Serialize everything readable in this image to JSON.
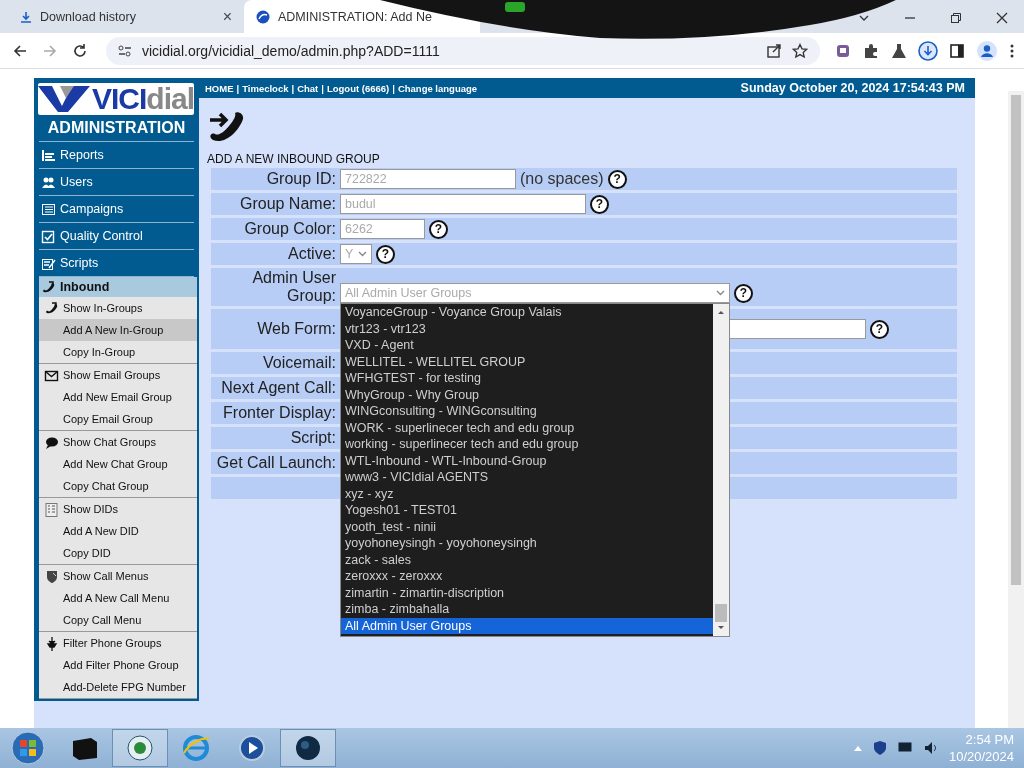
{
  "browser": {
    "tabs": [
      {
        "title": "Download history",
        "selected": false,
        "close": "×"
      },
      {
        "title": "ADMINISTRATION: Add Ne",
        "selected": true
      }
    ],
    "url": "vicidial.org/vicidial_demo/admin.php?ADD=1111"
  },
  "sidebar": {
    "logo": {
      "part_1": "VICI",
      "part_2": "dial"
    },
    "title": "ADMINISTRATION",
    "sections": [
      {
        "label": "Reports",
        "expanded": false
      },
      {
        "label": "Users",
        "expanded": false
      },
      {
        "label": "Campaigns",
        "expanded": false
      },
      {
        "label": "Quality Control",
        "expanded": false
      },
      {
        "label": "Scripts",
        "expanded": false
      },
      {
        "label": "Inbound",
        "expanded": true,
        "groups": [
          [
            {
              "label": "Show In-Groups",
              "selected": false
            },
            {
              "label": "Add A New In-Group",
              "selected": true
            },
            {
              "label": "Copy In-Group",
              "selected": false
            }
          ],
          [
            {
              "label": "Show Email Groups",
              "selected": false
            },
            {
              "label": "Add New Email Group",
              "selected": false
            },
            {
              "label": "Copy Email Group",
              "selected": false
            }
          ],
          [
            {
              "label": "Show Chat Groups",
              "selected": false
            },
            {
              "label": "Add New Chat Group",
              "selected": false
            },
            {
              "label": "Copy Chat Group",
              "selected": false
            }
          ],
          [
            {
              "label": "Show DIDs",
              "selected": false
            },
            {
              "label": "Add A New DID",
              "selected": false
            },
            {
              "label": "Copy DID",
              "selected": false
            }
          ],
          [
            {
              "label": "Show Call Menus",
              "selected": false
            },
            {
              "label": "Add A New Call Menu",
              "selected": false
            },
            {
              "label": "Copy Call Menu",
              "selected": false
            }
          ],
          [
            {
              "label": "Filter Phone Groups",
              "selected": false
            },
            {
              "label": "Add Filter Phone Group",
              "selected": false
            },
            {
              "label": "Add-Delete FPG Number",
              "selected": false
            }
          ]
        ]
      }
    ]
  },
  "top_links": {
    "separator": "|",
    "links": [
      "HOME",
      "Timeclock",
      "Chat",
      "Logout (6666)",
      "Change language"
    ]
  },
  "datetime": "Sunday October 20, 2024 17:54:43 PM",
  "form": {
    "title": "ADD A NEW INBOUND GROUP",
    "fields": [
      {
        "label": "Group ID:",
        "kind": "text",
        "value": "722822",
        "note": "(no spaces)",
        "help": "?"
      },
      {
        "label": "Group Name:",
        "kind": "text",
        "value": "budul",
        "help": "?"
      },
      {
        "label": "Group Color:",
        "kind": "text",
        "value": "6262",
        "help": "?"
      },
      {
        "label": "Active:",
        "kind": "select",
        "value": "Y",
        "help": "?"
      },
      {
        "label": "Admin User Group:",
        "kind": "open-select",
        "value": "All Admin User Groups",
        "help": "?",
        "options": [
          {
            "label": "VoyanceGroup - Voyance Group Valais",
            "selected": false
          },
          {
            "label": "vtr123 - vtr123",
            "selected": false
          },
          {
            "label": "VXD - Agent",
            "selected": false
          },
          {
            "label": "WELLITEL - WELLITEL GROUP",
            "selected": false
          },
          {
            "label": "WFHGTEST - for testing",
            "selected": false
          },
          {
            "label": "WhyGroup - Why Group",
            "selected": false
          },
          {
            "label": "WINGconsulting - WINGconsulting",
            "selected": false
          },
          {
            "label": "WORK - superlinecer tech and edu group",
            "selected": false
          },
          {
            "label": "working - superlinecer tech and edu group",
            "selected": false
          },
          {
            "label": "WTL-Inbound - WTL-Inbound-Group",
            "selected": false
          },
          {
            "label": "www3 - VICIdial AGENTS",
            "selected": false
          },
          {
            "label": "xyz - xyz",
            "selected": false
          },
          {
            "label": "Yogesh01 - TEST01",
            "selected": false
          },
          {
            "label": "yooth_test - ninii",
            "selected": false
          },
          {
            "label": "yoyohoneysingh - yoyohoneysingh",
            "selected": false
          },
          {
            "label": "zack - sales",
            "selected": false
          },
          {
            "label": "zeroxxx - zeroxxx",
            "selected": false
          },
          {
            "label": "zimartin - zimartin-discription",
            "selected": false
          },
          {
            "label": "zimba - zimbahalla",
            "selected": false
          },
          {
            "label": "All Admin User Groups",
            "selected": true
          }
        ]
      },
      {
        "label": "Web Form:",
        "kind": "covered-text",
        "help": "?"
      },
      {
        "label": "Voicemail:",
        "kind": "covered"
      },
      {
        "label": "Next Agent Call:",
        "kind": "covered"
      },
      {
        "label": "Fronter Display:",
        "kind": "covered"
      },
      {
        "label": "Script:",
        "kind": "covered"
      },
      {
        "label": "Get Call Launch:",
        "kind": "covered"
      },
      {
        "kind": "empty"
      }
    ]
  },
  "taskbar": {
    "time": "2:54 PM",
    "date": "10/20/2024"
  }
}
